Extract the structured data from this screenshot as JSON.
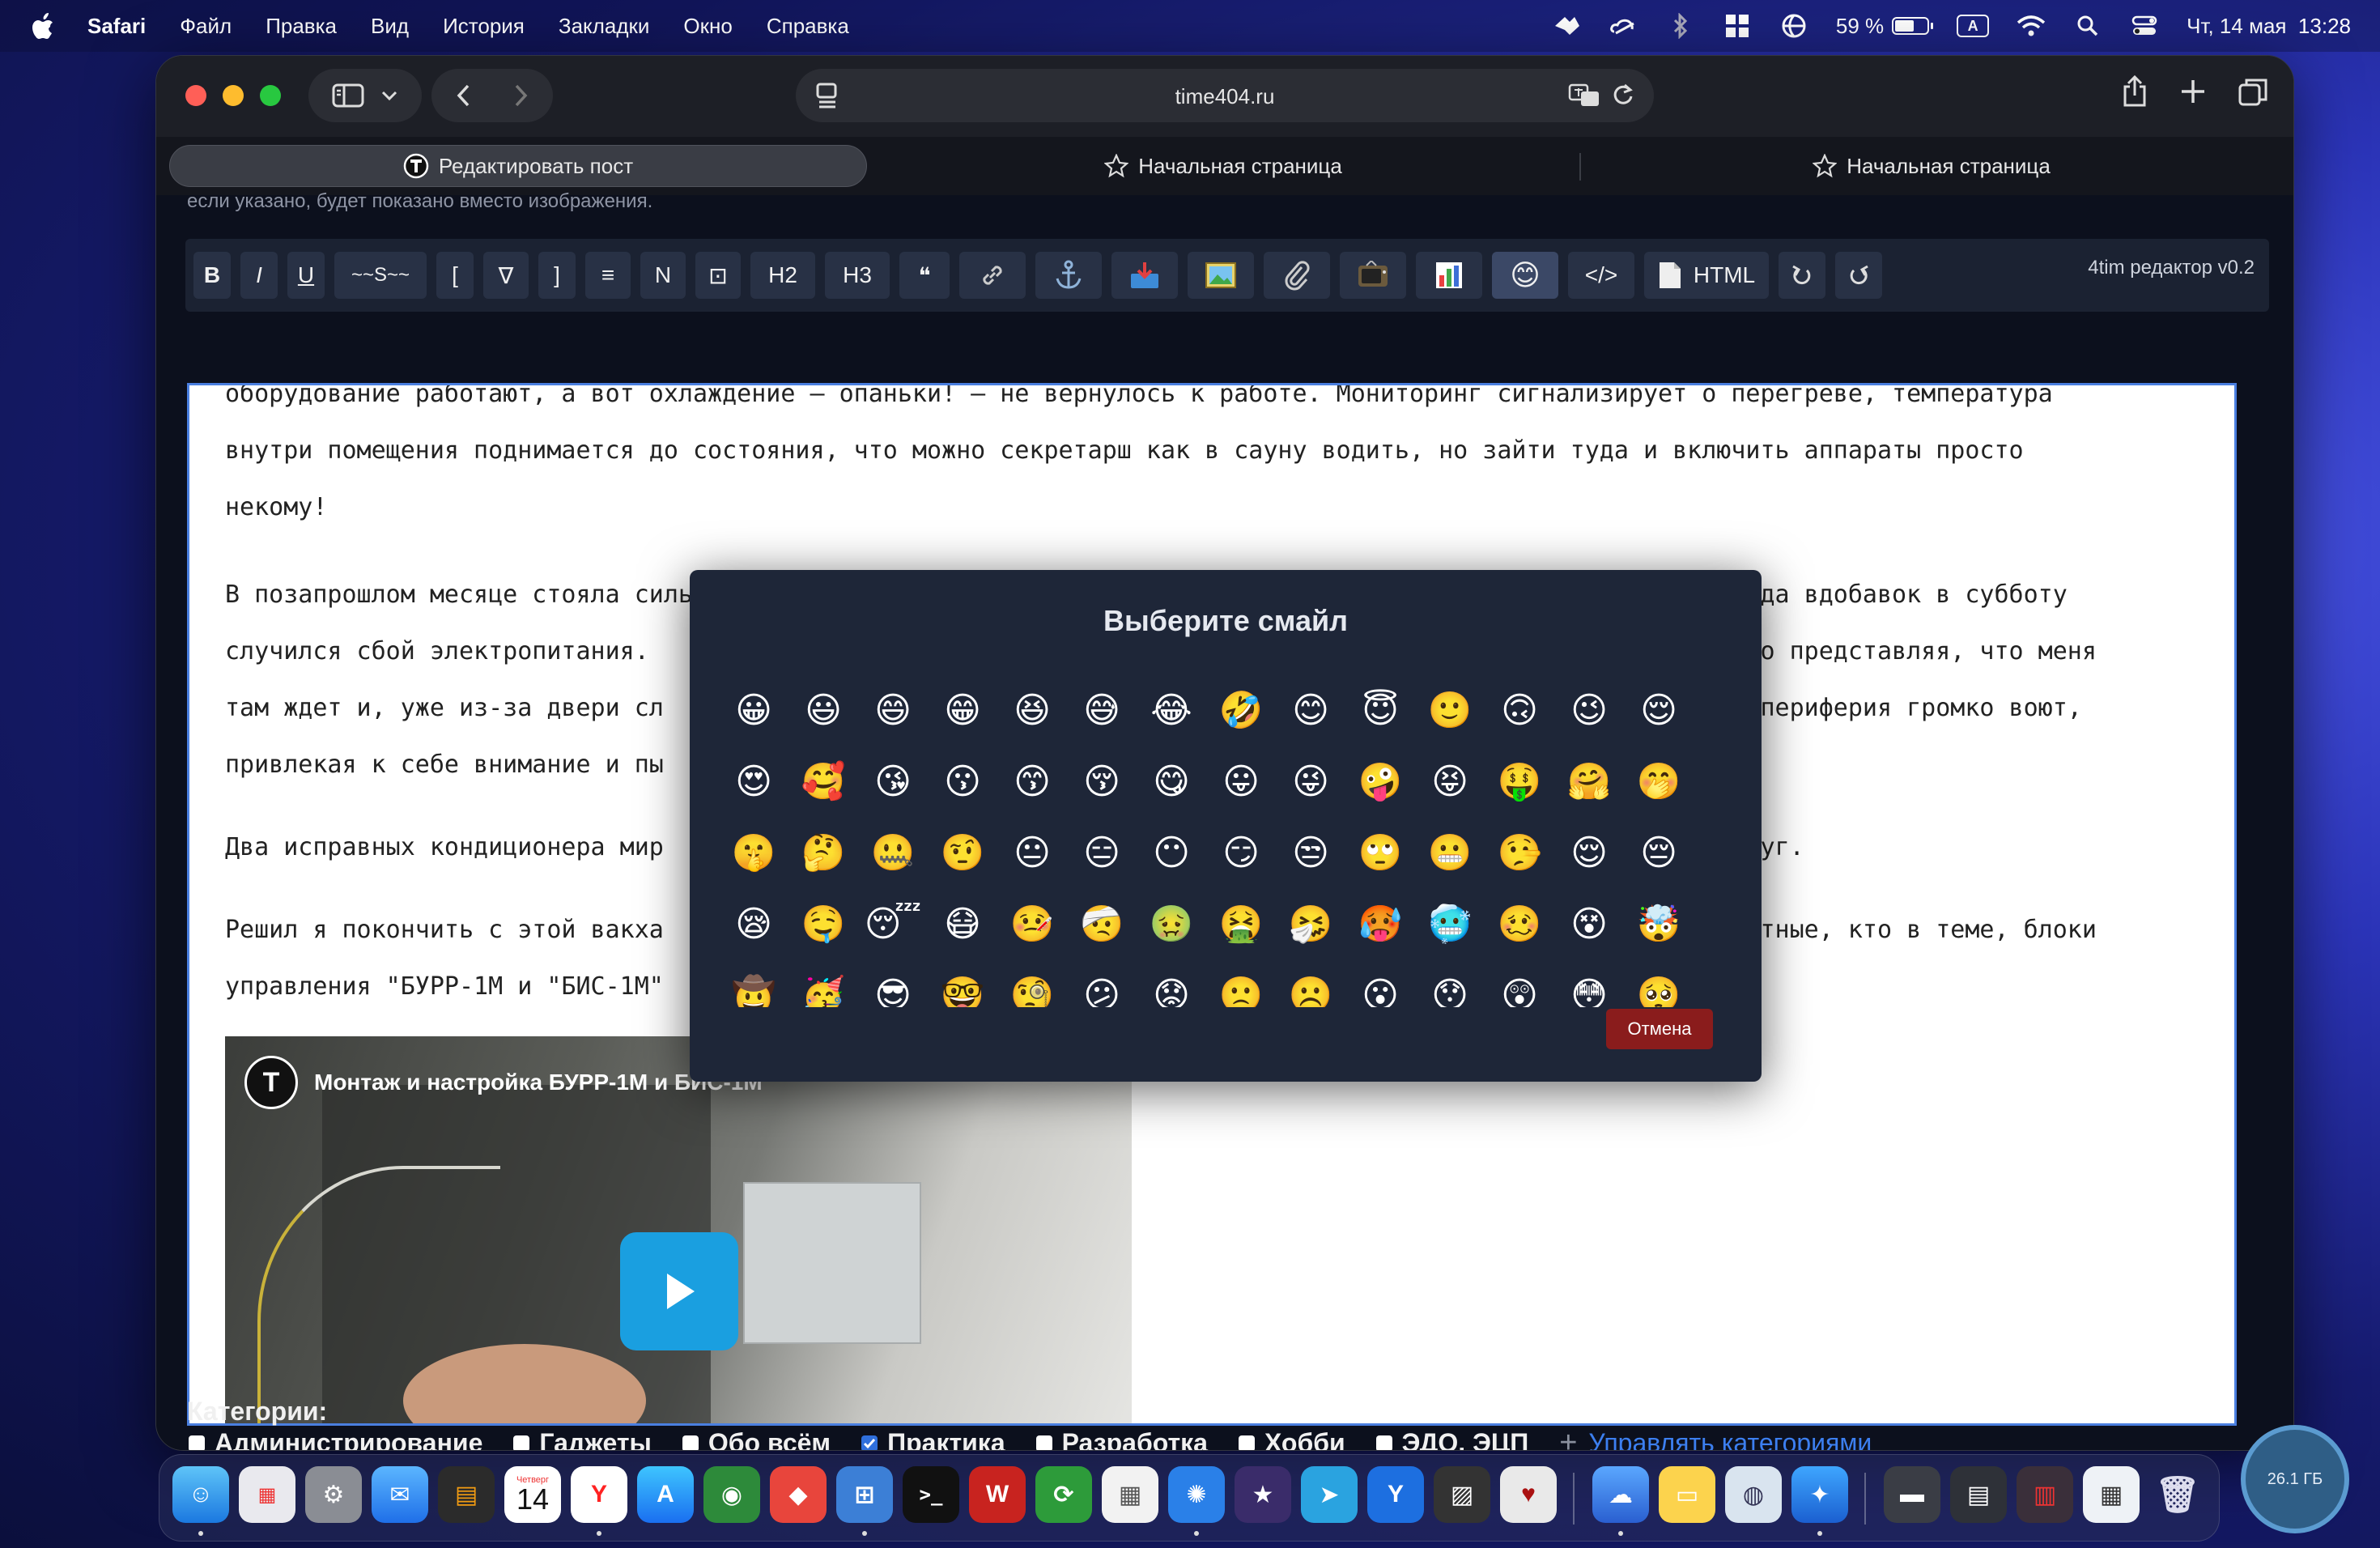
{
  "menubar": {
    "app": "Safari",
    "items": [
      "Файл",
      "Правка",
      "Вид",
      "История",
      "Закладки",
      "Окно",
      "Справка"
    ],
    "battery": "59 %",
    "input_source": "A",
    "datetime": "Чт, 14 мая  13:28"
  },
  "browser": {
    "url": "time404.ru",
    "tabs": [
      {
        "label": "Редактировать пост"
      },
      {
        "label": "Начальная страница"
      },
      {
        "label": "Начальная страница"
      }
    ]
  },
  "page": {
    "hint": "если указано, будет показано вместо изображения.",
    "toolbar": {
      "bold": "B",
      "italic": "I",
      "underline": "U",
      "strike": "~~S~~",
      "bracket_left": "[",
      "nabla": "∇",
      "bracket_right": "]",
      "list": "≡",
      "numbered": "N",
      "box": "⊡",
      "h2": "H2",
      "h3": "H3",
      "quote": "❝",
      "code": "</>",
      "html": "HTML",
      "version": "4tim редактор v0.2"
    },
    "paragraphs": [
      "оборудование работают, а вот охлаждение — опаньки! — не вернулось к работе. Мониторинг сигнализирует о перегреве, температура",
      "внутри помещения поднимается до состояния, что можно секретарш как в сауну водить, но зайти туда и включить аппараты просто",
      "некому!",
      "В позапрошлом месяце стояла сильная жара, когда один работающий кондиционер едва справлялся с нагрузкой, да вдобавок в субботу",
      "случился сбой электропитания.                                                                        мерно представляя, что меня",
      "там ждет и, уже из-за двери сл                                                                       вся периферия громко воют,",
      "привлекая к себе внимание и пы",
      "Два исправных кондиционера мир                                                                       вокруг.",
      "Решил я покончить с этой вакха                                                                       звестные, кто в теме, блоки",
      "управления \"БУРР-1М и \"БИС-1М\""
    ],
    "video": {
      "title": "Монтаж и настройка БУРР-1М и БИС-1М"
    },
    "categories": {
      "title": "Категории:",
      "items": [
        {
          "label": "Администрирование",
          "checked": false
        },
        {
          "label": "Гаджеты",
          "checked": false
        },
        {
          "label": "Обо всём",
          "checked": false
        },
        {
          "label": "Практика",
          "checked": true
        },
        {
          "label": "Разработка",
          "checked": false
        },
        {
          "label": "Хобби",
          "checked": false
        },
        {
          "label": "ЭДО, ЭЦП",
          "checked": false
        }
      ],
      "manage": "Управлять категориями"
    }
  },
  "modal": {
    "title": "Выберите смайл",
    "emojis": [
      "😀",
      "😃",
      "😄",
      "😁",
      "😆",
      "😅",
      "😂",
      "🤣",
      "😊",
      "😇",
      "🙂",
      "🙃",
      "😉",
      "😌",
      "😍",
      "🥰",
      "😘",
      "😗",
      "😙",
      "😚",
      "😋",
      "😛",
      "😜",
      "🤪",
      "😝",
      "🤑",
      "🤗",
      "🤭",
      "🤫",
      "🤔",
      "🤐",
      "🤨",
      "😐",
      "😑",
      "😶",
      "😏",
      "😒",
      "🙄",
      "😬",
      "🤥",
      "😌",
      "😔",
      "😪",
      "🤤",
      "😴",
      "😷",
      "🤒",
      "🤕",
      "🤢",
      "🤮",
      "🤧",
      "🥵",
      "🥶",
      "🥴",
      "😵",
      "🤯",
      "🤠",
      "🥳",
      "😎",
      "🤓",
      "🧐",
      "😕",
      "😟",
      "🙁",
      "☹️",
      "😮",
      "😯",
      "😲",
      "😳",
      "🥺"
    ],
    "cancel": "Отмена"
  },
  "dock": {
    "calendar_month": "Четверг",
    "calendar_day": "14",
    "disk": "26.1 ГБ"
  },
  "colors": {
    "accent": "#2f6fdc",
    "editor_border": "#4a7fe0",
    "cancel": "#8a1c1c",
    "modal_bg": "#1e2638"
  }
}
